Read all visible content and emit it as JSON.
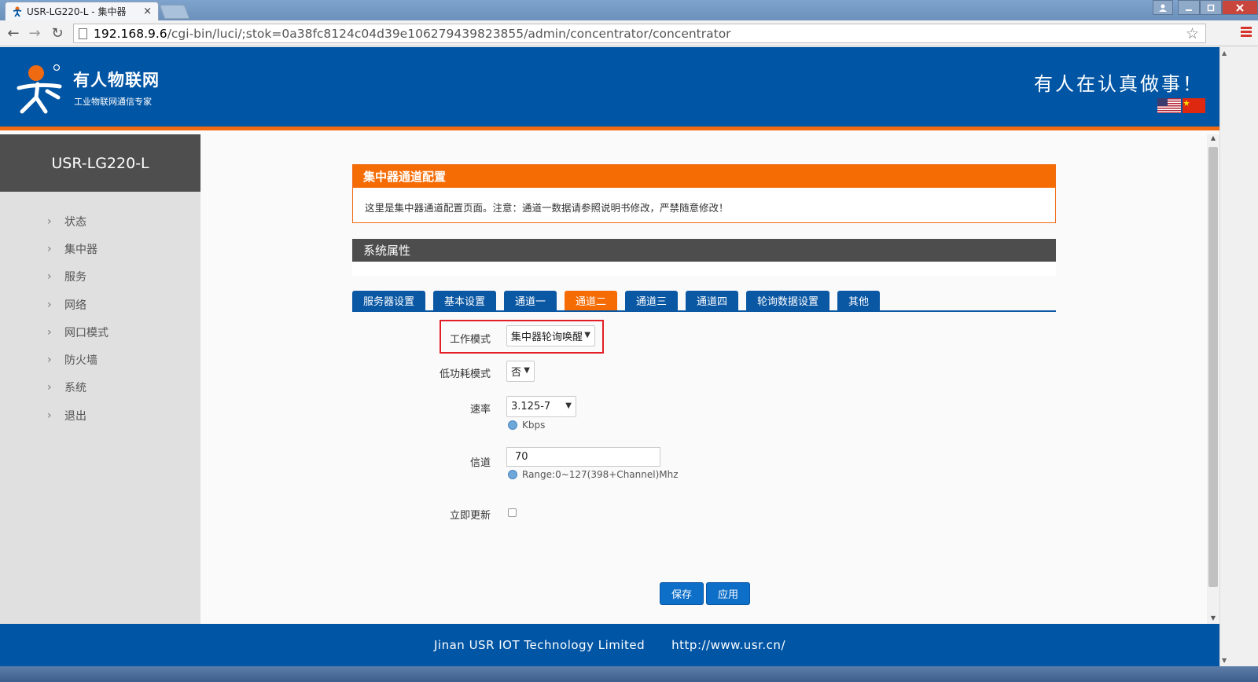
{
  "browser": {
    "tab_title": "USR-LG220-L - 集中器",
    "tab_close": "×",
    "url_host": "192.168.9.6",
    "url_path": "/cgi-bin/luci/;stok=0a38fc8124c04d39e106279439823855/admin/concentrator/concentrator",
    "back": "←",
    "forward": "→",
    "reload": "↻",
    "star": "☆"
  },
  "header": {
    "brand_name": "有人物联网",
    "brand_sub": "工业物联网通信专家",
    "slogan": "有人在认真做事！"
  },
  "sidebar": {
    "title": "USR-LG220-L",
    "items": [
      {
        "label": "状态"
      },
      {
        "label": "集中器"
      },
      {
        "label": "服务"
      },
      {
        "label": "网络"
      },
      {
        "label": "网口模式"
      },
      {
        "label": "防火墙"
      },
      {
        "label": "系统"
      },
      {
        "label": "退出"
      }
    ]
  },
  "notice": {
    "title": "集中器通道配置",
    "body": "这里是集中器通道配置页面。注意：通道一数据请参照说明书修改，严禁随意修改！"
  },
  "section": {
    "title": "系统属性"
  },
  "tabs": [
    {
      "label": "服务器设置"
    },
    {
      "label": "基本设置"
    },
    {
      "label": "通道一"
    },
    {
      "label": "通道二"
    },
    {
      "label": "通道三"
    },
    {
      "label": "通道四"
    },
    {
      "label": "轮询数据设置"
    },
    {
      "label": "其他"
    }
  ],
  "active_tab": "通道二",
  "form": {
    "work_mode": {
      "label": "工作模式",
      "value": "集中器轮询唤醒"
    },
    "low_power": {
      "label": "低功耗模式",
      "value": "否"
    },
    "rate": {
      "label": "速率",
      "value": "3.125-7",
      "hint": "Kbps"
    },
    "channel": {
      "label": "信道",
      "value": "70",
      "hint": "Range:0~127(398+Channel)Mhz"
    },
    "update_now": {
      "label": "立即更新",
      "checked": false
    }
  },
  "actions": {
    "save": "保存",
    "apply": "应用"
  },
  "footer": {
    "company": "Jinan USR IOT Technology Limited",
    "url": "http://www.usr.cn/"
  },
  "colors": {
    "header_blue": "#0055a4",
    "accent_orange": "#f56c05",
    "tab_blue": "#0a57a3",
    "highlight_red": "#e21f26"
  }
}
